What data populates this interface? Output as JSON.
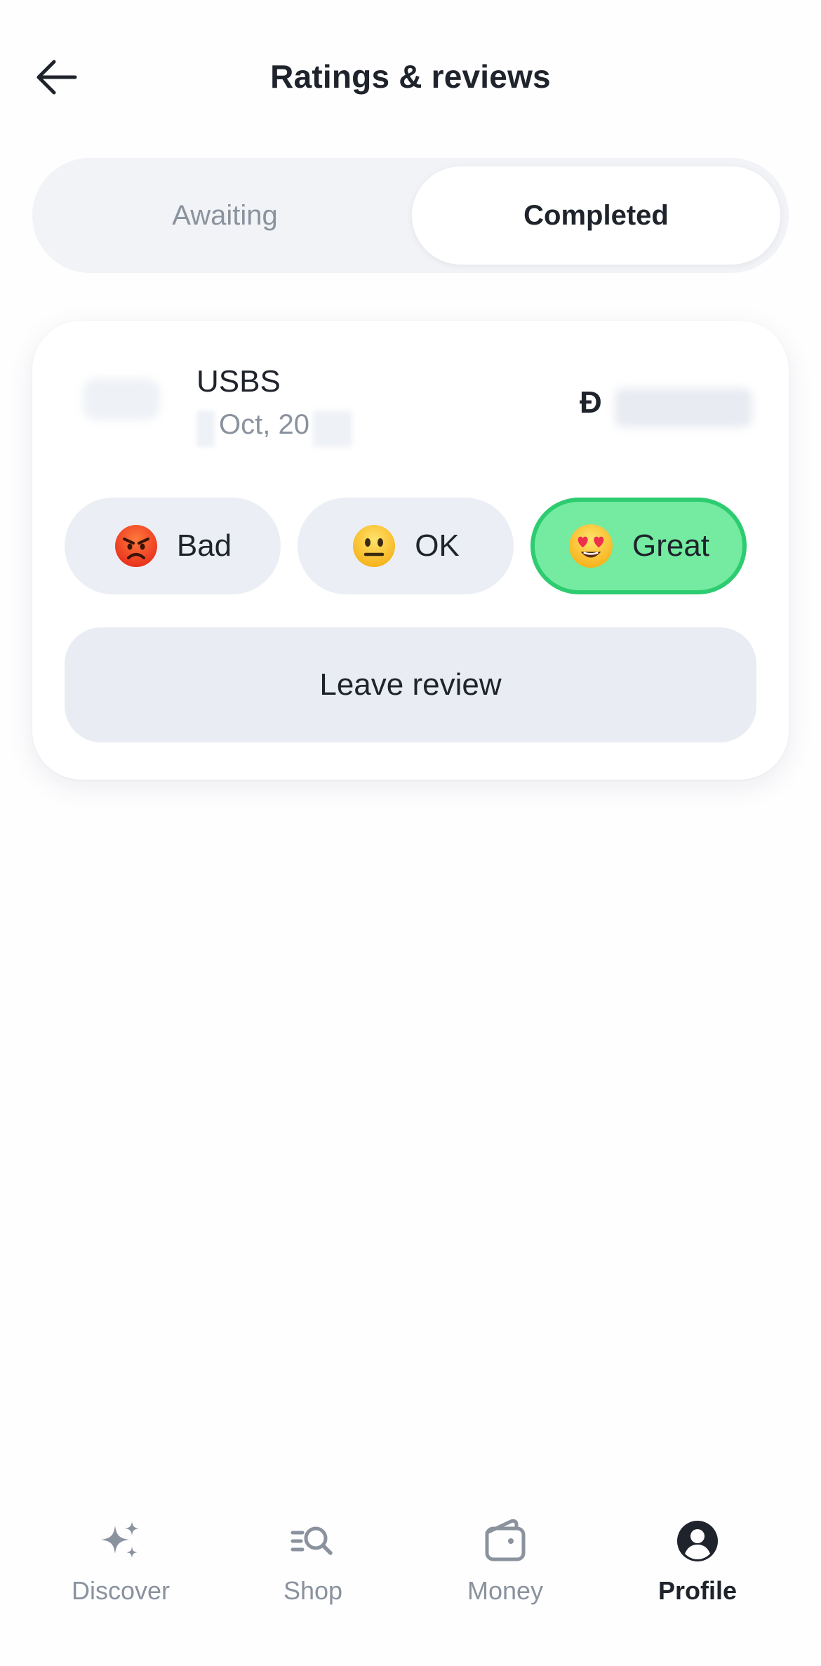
{
  "header": {
    "title": "Ratings & reviews"
  },
  "tabs": [
    {
      "label": "Awaiting",
      "selected": false
    },
    {
      "label": "Completed",
      "selected": true
    }
  ],
  "order": {
    "merchant": "USBS",
    "date": "Oct, 20",
    "currency_symbol": "Đ"
  },
  "ratings": [
    {
      "label": "Bad",
      "icon": "angry-face-icon",
      "selected": false
    },
    {
      "label": "OK",
      "icon": "neutral-face-icon",
      "selected": false
    },
    {
      "label": "Great",
      "icon": "heart-eyes-face-icon",
      "selected": true
    }
  ],
  "actions": {
    "leave_review": "Leave review"
  },
  "bottom_nav": [
    {
      "label": "Discover",
      "icon": "sparkles-icon",
      "active": false
    },
    {
      "label": "Shop",
      "icon": "search-list-icon",
      "active": false
    },
    {
      "label": "Money",
      "icon": "wallet-icon",
      "active": false
    },
    {
      "label": "Profile",
      "icon": "profile-icon",
      "active": true
    }
  ],
  "colors": {
    "selected_rating_fill": "#74EBA1",
    "selected_rating_border": "#2ECC71",
    "muted_text": "#8A929E",
    "primary_text": "#1F232B"
  }
}
